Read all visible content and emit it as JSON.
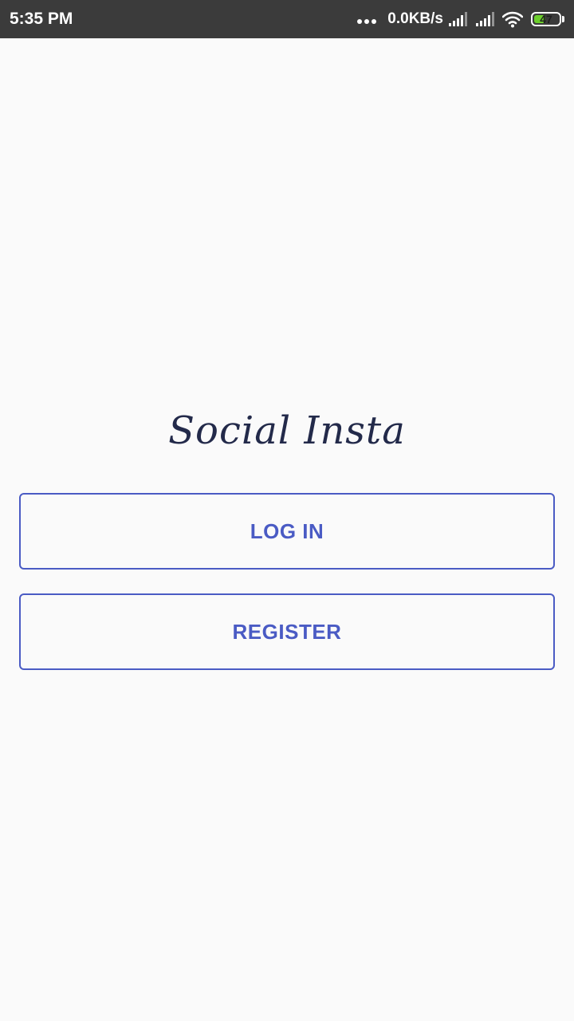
{
  "status_bar": {
    "time": "5:35 PM",
    "network_speed": "0.0KB/s",
    "battery_level": 47,
    "battery_label": "47",
    "icons": [
      "more-dots-icon",
      "signal-icon",
      "signal-icon",
      "wifi-icon",
      "battery-icon"
    ],
    "colors": {
      "background": "#3b3b3b",
      "battery": "#6ccf2c"
    }
  },
  "app": {
    "logo_text": "Social Insta",
    "accent_color": "#4a5bc4",
    "login_label": "LOG IN",
    "register_label": "REGISTER"
  }
}
